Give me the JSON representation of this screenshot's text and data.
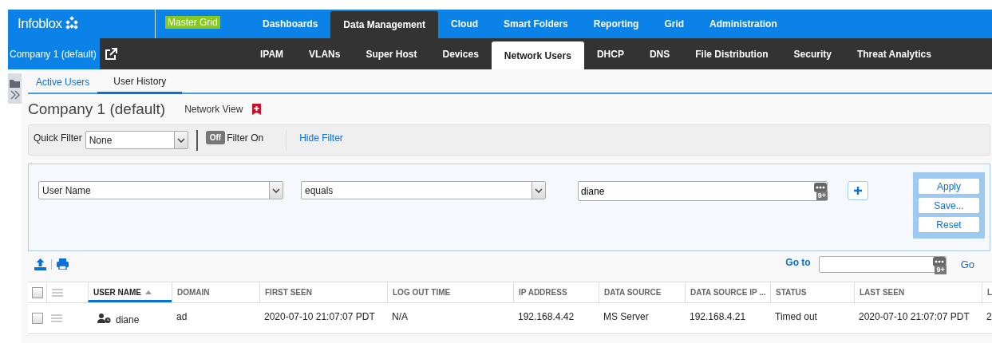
{
  "brand": {
    "name": "Infoblox"
  },
  "grid_badge": "Master Grid",
  "main_nav": [
    {
      "label": "Dashboards",
      "selected": false
    },
    {
      "label": "Data Management",
      "selected": true
    },
    {
      "label": "Cloud",
      "selected": false
    },
    {
      "label": "Smart Folders",
      "selected": false
    },
    {
      "label": "Reporting",
      "selected": false
    },
    {
      "label": "Grid",
      "selected": false
    },
    {
      "label": "Administration",
      "selected": false
    }
  ],
  "context": {
    "label": "Company 1 (default)"
  },
  "sub_nav": [
    {
      "label": "IPAM",
      "selected": false
    },
    {
      "label": "VLANs",
      "selected": false
    },
    {
      "label": "Super Host",
      "selected": false
    },
    {
      "label": "Devices",
      "selected": false
    },
    {
      "label": "Network Users",
      "selected": true
    },
    {
      "label": "DHCP",
      "selected": false
    },
    {
      "label": "DNS",
      "selected": false
    },
    {
      "label": "File Distribution",
      "selected": false
    },
    {
      "label": "Security",
      "selected": false
    },
    {
      "label": "Threat Analytics",
      "selected": false
    }
  ],
  "page_tabs": [
    {
      "label": "Active Users",
      "selected": false
    },
    {
      "label": "User History",
      "selected": true
    }
  ],
  "header": {
    "title": "Company 1 (default)",
    "network_view_label": "Network View"
  },
  "quick_filter": {
    "label": "Quick Filter",
    "value": "None",
    "toggle": {
      "label": "Off",
      "on": false
    },
    "filter_state": "Filter On",
    "hide_filter": "Hide Filter"
  },
  "filter_rule": {
    "field": "User Name",
    "operator": "equals",
    "value": "diane",
    "badge": "9+"
  },
  "filter_actions": [
    "Apply",
    "Save...",
    "Reset"
  ],
  "goto": {
    "label": "Go to",
    "badge": "9+",
    "go": "Go"
  },
  "table": {
    "all_checked": false,
    "columns": [
      {
        "label": "USER NAME",
        "sorted": true
      },
      {
        "label": "DOMAIN",
        "sorted": false
      },
      {
        "label": "FIRST SEEN",
        "sorted": false
      },
      {
        "label": "LOG OUT TIME",
        "sorted": false
      },
      {
        "label": "IP ADDRESS",
        "sorted": false
      },
      {
        "label": "DATA SOURCE",
        "sorted": false
      },
      {
        "label": "DATA SOURCE IP ...",
        "sorted": false
      },
      {
        "label": "STATUS",
        "sorted": false
      },
      {
        "label": "LAST SEEN",
        "sorted": false
      },
      {
        "label": "L",
        "sorted": false
      }
    ],
    "rows": [
      {
        "checked": false,
        "cells": [
          "diane",
          "ad",
          "2020-07-10 21:07:07 PDT",
          "N/A",
          "192.168.4.42",
          "MS Server",
          "192.168.4.21",
          "Timed out",
          "2020-07-10 21:07:07 PDT",
          "2"
        ]
      }
    ]
  }
}
